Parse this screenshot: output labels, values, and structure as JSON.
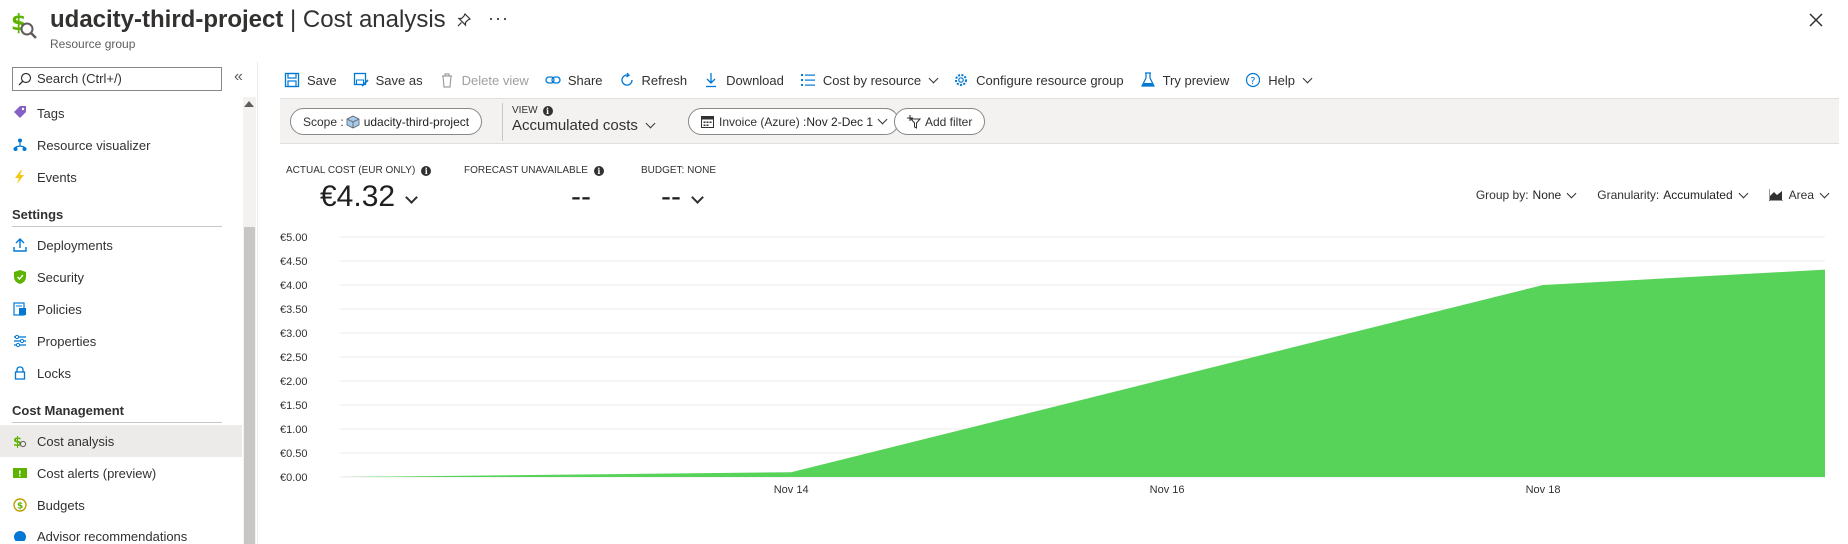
{
  "header": {
    "resource_name": "udacity-third-project",
    "separator": " | ",
    "page_title": "Cost analysis",
    "subtitle": "Resource group",
    "more_label": "···"
  },
  "sidebar": {
    "search_placeholder": "Search (Ctrl+/)",
    "collapse_label": "«",
    "items": [
      {
        "label": "Tags",
        "icon": "tag-icon"
      },
      {
        "label": "Resource visualizer",
        "icon": "resource-visualizer-icon"
      },
      {
        "label": "Events",
        "icon": "lightning-icon"
      }
    ],
    "settings_title": "Settings",
    "settings_items": [
      {
        "label": "Deployments",
        "icon": "upload-icon"
      },
      {
        "label": "Security",
        "icon": "shield-icon"
      },
      {
        "label": "Policies",
        "icon": "policy-icon"
      },
      {
        "label": "Properties",
        "icon": "properties-icon"
      },
      {
        "label": "Locks",
        "icon": "lock-icon"
      }
    ],
    "cost_title": "Cost Management",
    "cost_items": [
      {
        "label": "Cost analysis",
        "icon": "cost-analysis-icon",
        "active": true
      },
      {
        "label": "Cost alerts (preview)",
        "icon": "cost-alert-icon"
      },
      {
        "label": "Budgets",
        "icon": "budget-icon"
      },
      {
        "label": "Advisor recommendations",
        "icon": "advisor-icon"
      }
    ]
  },
  "toolbar": {
    "save": "Save",
    "save_as": "Save as",
    "delete_view": "Delete view",
    "share": "Share",
    "refresh": "Refresh",
    "download": "Download",
    "cost_by_resource": "Cost by resource",
    "configure": "Configure resource group",
    "try_preview": "Try preview",
    "help": "Help"
  },
  "filters": {
    "scope_label": "Scope : ",
    "scope_value": "udacity-third-project",
    "view_label": "VIEW",
    "view_value": "Accumulated costs",
    "date_label": "Invoice (Azure) : ",
    "date_value": "Nov 2-Dec 1",
    "add_filter": "Add filter"
  },
  "kpis": {
    "actual_label": "ACTUAL COST (EUR ONLY)",
    "actual_value": "€4.32",
    "forecast_label": "FORECAST UNAVAILABLE",
    "forecast_value": "--",
    "budget_label": "BUDGET: NONE",
    "budget_value": "--"
  },
  "controls": {
    "group_by_label": "Group by:",
    "group_by_value": "None",
    "granularity_label": "Granularity:",
    "granularity_value": "Accumulated",
    "chart_type": "Area"
  },
  "colors": {
    "area_fill": "#57d35a",
    "accent": "#0078d4"
  },
  "chart_data": {
    "type": "area",
    "x_ticks": [
      "Nov 14",
      "Nov 16",
      "Nov 18"
    ],
    "y_ticks": [
      "€0.00",
      "€0.50",
      "€1.00",
      "€1.50",
      "€2.00",
      "€2.50",
      "€3.00",
      "€3.50",
      "€4.00",
      "€4.50",
      "€5.00"
    ],
    "ylim": [
      0,
      5
    ],
    "xlim": [
      11.6,
      19.5
    ],
    "series": [
      {
        "x": [
          11.6,
          14.0,
          18.0,
          19.5
        ],
        "values": [
          0.0,
          0.1,
          4.0,
          4.32
        ]
      }
    ],
    "grid": true
  }
}
